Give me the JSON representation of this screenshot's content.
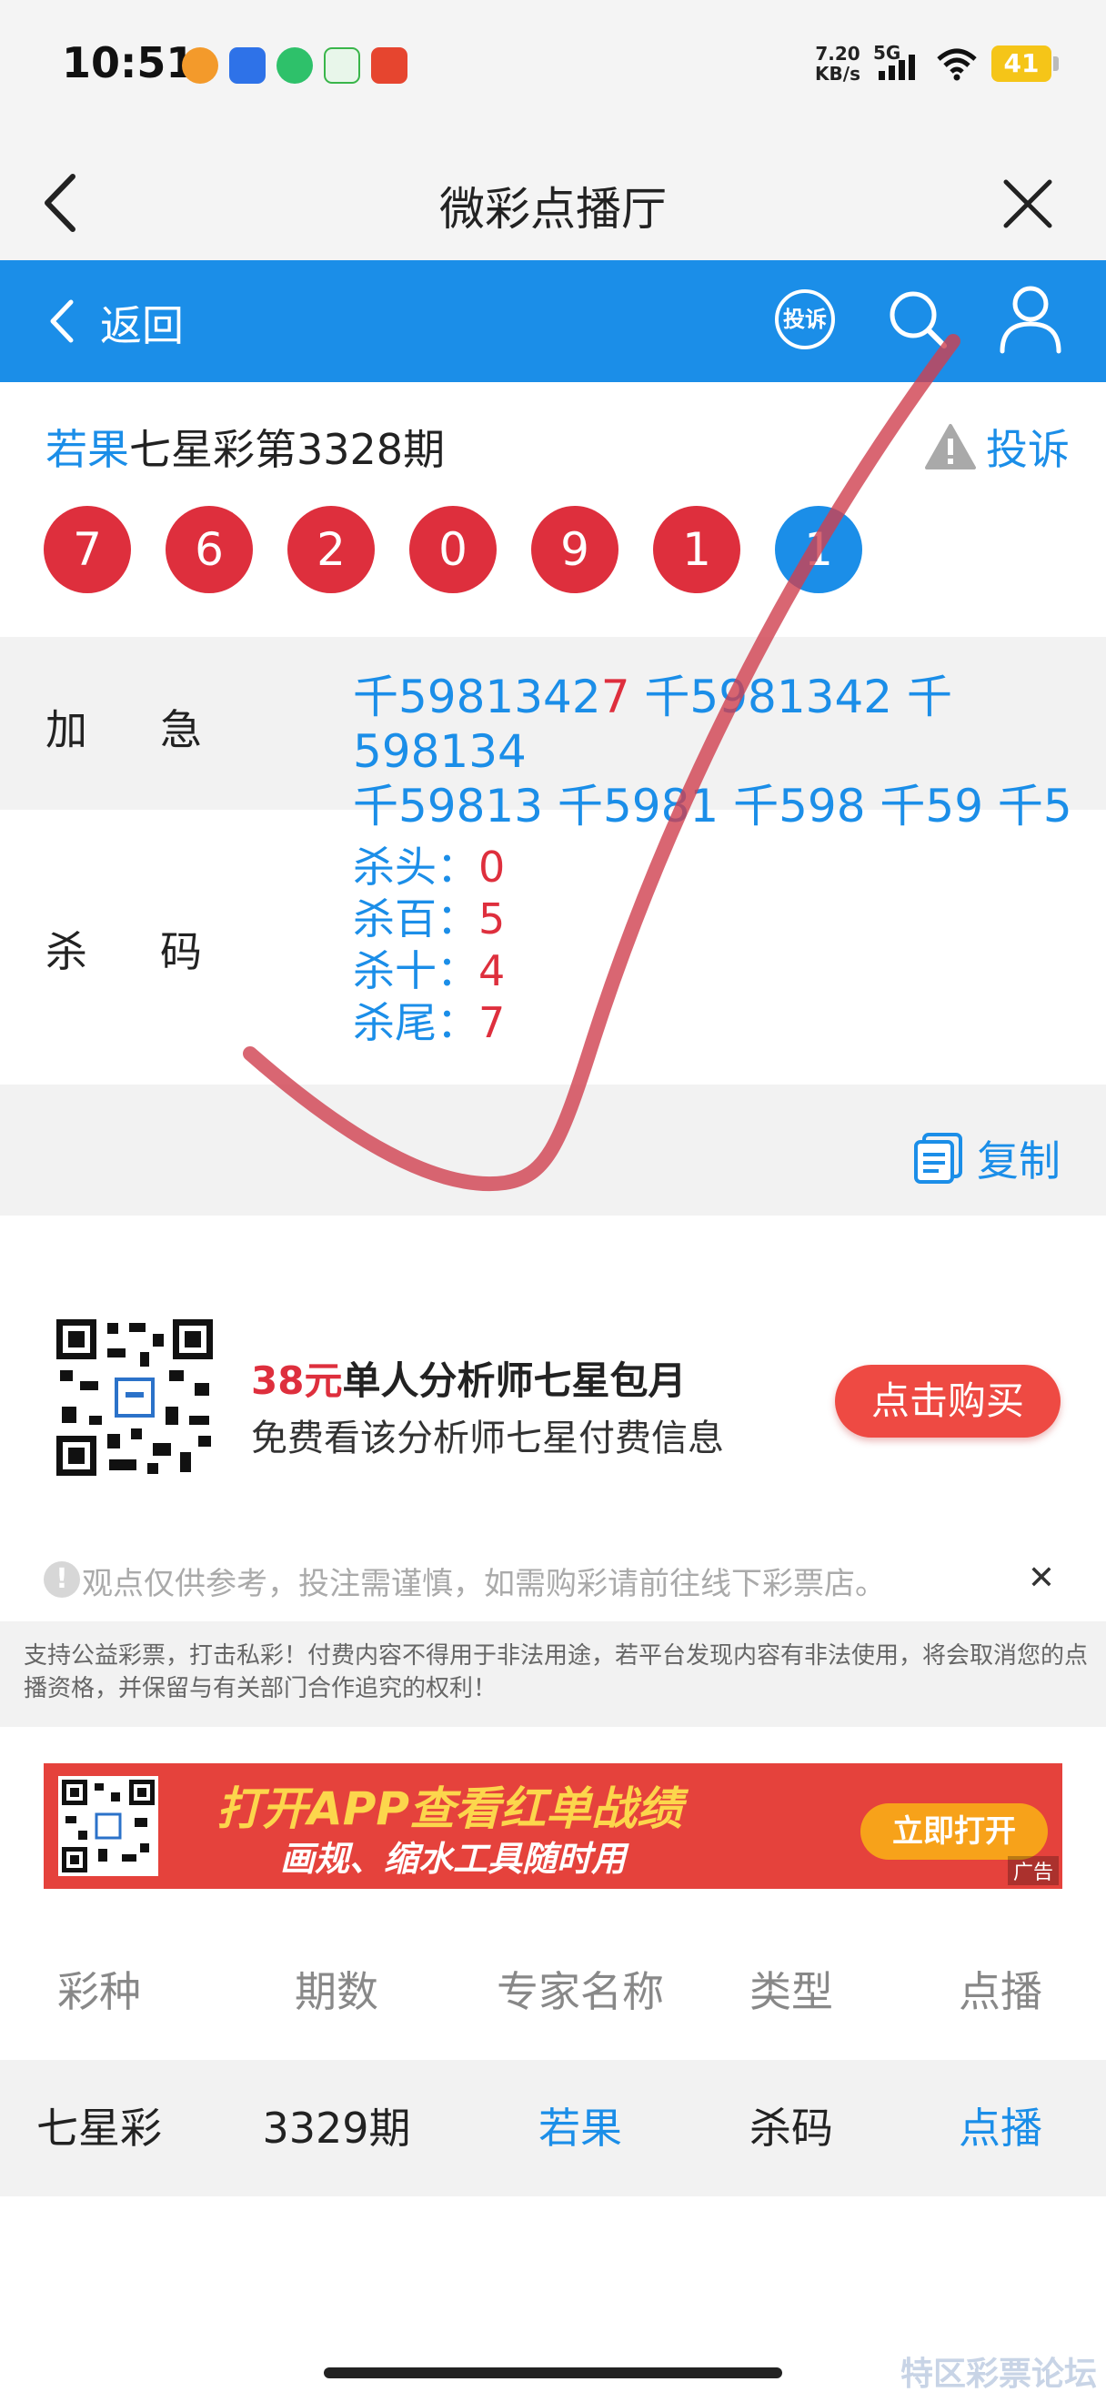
{
  "status_bar": {
    "time": "10:51",
    "net_speed_value": "7.20",
    "net_speed_unit": "KB/s",
    "network": "5G",
    "battery": "41"
  },
  "titlebar": {
    "title": "微彩点播厅"
  },
  "header": {
    "back_label": "返回",
    "complaint_label": "投诉"
  },
  "issue": {
    "author": "若果",
    "title_rest": "七星彩第3328期",
    "report_label": "投诉",
    "balls": [
      "7",
      "6",
      "2",
      "0",
      "9",
      "1",
      "1"
    ]
  },
  "jiaji": {
    "label_chars": [
      "加",
      "急"
    ],
    "line1_a": "千5981342",
    "line1_red": "7",
    "line1_b": " 千5981342 千598134",
    "line2": "千59813 千5981 千598 千59 千5"
  },
  "shama": {
    "label_chars": [
      "杀",
      "码"
    ],
    "items": [
      {
        "label": "杀头：",
        "value": "0"
      },
      {
        "label": "杀百：",
        "value": "5"
      },
      {
        "label": "杀十：",
        "value": "4"
      },
      {
        "label": "杀尾：",
        "value": "7"
      }
    ]
  },
  "copy_label": "复制",
  "promo": {
    "price": "38元",
    "title": "单人分析师七星包月",
    "subtitle": "免费看该分析师七星付费信息",
    "button": "点击购买"
  },
  "notice": "观点仅供参考，投注需谨慎，如需购彩请前往线下彩票店。",
  "disclaimer": "支持公益彩票，打击私彩！付费内容不得用于非法用途，若平台发现内容有非法使用，将会取消您的点播资格，并保留与有关部门合作追究的权利！",
  "banner": {
    "title": "打开APP查看红单战绩",
    "subtitle": "画规、缩水工具随时用",
    "button": "立即打开",
    "ad_tag": "广告"
  },
  "table": {
    "headers": [
      "彩种",
      "期数",
      "专家名称",
      "类型",
      "点播"
    ],
    "rows": [
      [
        "七星彩",
        "3329期",
        "若果",
        "杀码",
        "点播"
      ]
    ]
  },
  "watermark": "特区彩票论坛",
  "colors": {
    "brand_blue": "#1b8ee8",
    "ball_red": "#de2f3d",
    "buy_red": "#ee4a43"
  }
}
